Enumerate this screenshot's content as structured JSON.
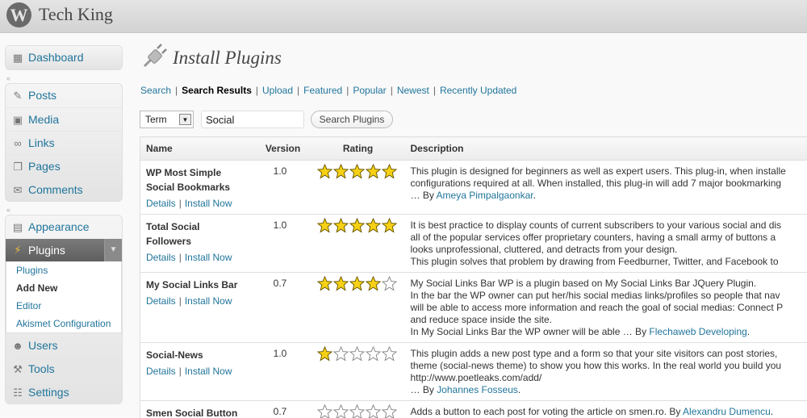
{
  "header": {
    "site_title": "Tech King",
    "logo_glyph": "W"
  },
  "sidebar": {
    "dashboard": "Dashboard",
    "group1": [
      "Posts",
      "Media",
      "Links",
      "Pages",
      "Comments"
    ],
    "appearance": "Appearance",
    "plugins": "Plugins",
    "plugins_sub": [
      "Plugins",
      "Add New",
      "Editor",
      "Akismet Configuration"
    ],
    "group3": [
      "Users",
      "Tools",
      "Settings"
    ]
  },
  "page": {
    "title": "Install Plugins",
    "nav": [
      "Search",
      "Search Results",
      "Upload",
      "Featured",
      "Popular",
      "Newest",
      "Recently Updated"
    ],
    "term_value": "Term",
    "search_value": "Social",
    "search_button": "Search Plugins"
  },
  "table": {
    "headers": [
      "Name",
      "Version",
      "Rating",
      "Description"
    ],
    "details_label": "Details",
    "install_label": "Install Now",
    "rows": [
      {
        "name_lines": [
          "WP Most Simple",
          "Social Bookmarks"
        ],
        "version": "1.0",
        "rating": 5,
        "desc_lines": [
          "This plugin is designed for beginners as well as expert users. This plug-in, when installe",
          "configurations required at all. When installed, this plug-in will add 7 major bookmarking"
        ],
        "by_prefix": "… By ",
        "author": "Ameya Pimpalgaonkar",
        "by_suffix": "."
      },
      {
        "name_lines": [
          "Total Social",
          "Followers"
        ],
        "version": "1.0",
        "rating": 5,
        "desc_lines": [
          "It is best practice to display counts of current subscribers to your various social and dis",
          "all of the popular services offer proprietary counters, having a small army of buttons a",
          "looks unprofessional, cluttered, and detracts from your design.",
          "This plugin solves that problem by drawing from Feedburner, Twitter, and Facebook to"
        ],
        "by_prefix": "",
        "author": "",
        "by_suffix": ""
      },
      {
        "name_lines": [
          "My Social Links Bar"
        ],
        "version": "0.7",
        "rating": 4,
        "desc_lines": [
          "My Social Links Bar WP is a plugin based on My Social Links Bar JQuery Plugin.",
          "In the bar the WP owner can put her/his social medias links/profiles so people that nav",
          "will be able to access more information and reach the goal of social medias: Connect P",
          "and reduce space inside the site."
        ],
        "by_prefix": "In My Social Links Bar the WP owner will be able … By ",
        "author": "Flechaweb Developing",
        "by_suffix": "."
      },
      {
        "name_lines": [
          "Social-News"
        ],
        "version": "1.0",
        "rating": 1,
        "desc_lines": [
          "This plugin adds a new post type and a form so that your site visitors can post stories,",
          "theme (social-news theme) to show you how this works. In the real world you build you",
          "http://www.poetleaks.com/add/"
        ],
        "by_prefix": "… By ",
        "author": "Johannes Fosseus",
        "by_suffix": "."
      },
      {
        "name_lines": [
          "Smen Social Button"
        ],
        "version": "0.7",
        "rating": 0,
        "desc_lines": [],
        "by_prefix": "Adds a button to each post for voting the article on smen.ro. By ",
        "author": "Alexandru Dumencu",
        "by_suffix": "."
      }
    ]
  },
  "colors": {
    "link": "#21759b",
    "star_fill": "#f7d116",
    "star_stroke": "#6a5a00",
    "active_menu": "#6b6b6b"
  },
  "icons": [
    "wordpress-logo-icon",
    "plugin-plug-icon",
    "pin-icon",
    "media-icon",
    "link-icon",
    "pages-icon",
    "comments-icon",
    "appearance-icon",
    "plugins-icon",
    "users-icon",
    "tools-icon",
    "settings-icon",
    "star-icon"
  ]
}
